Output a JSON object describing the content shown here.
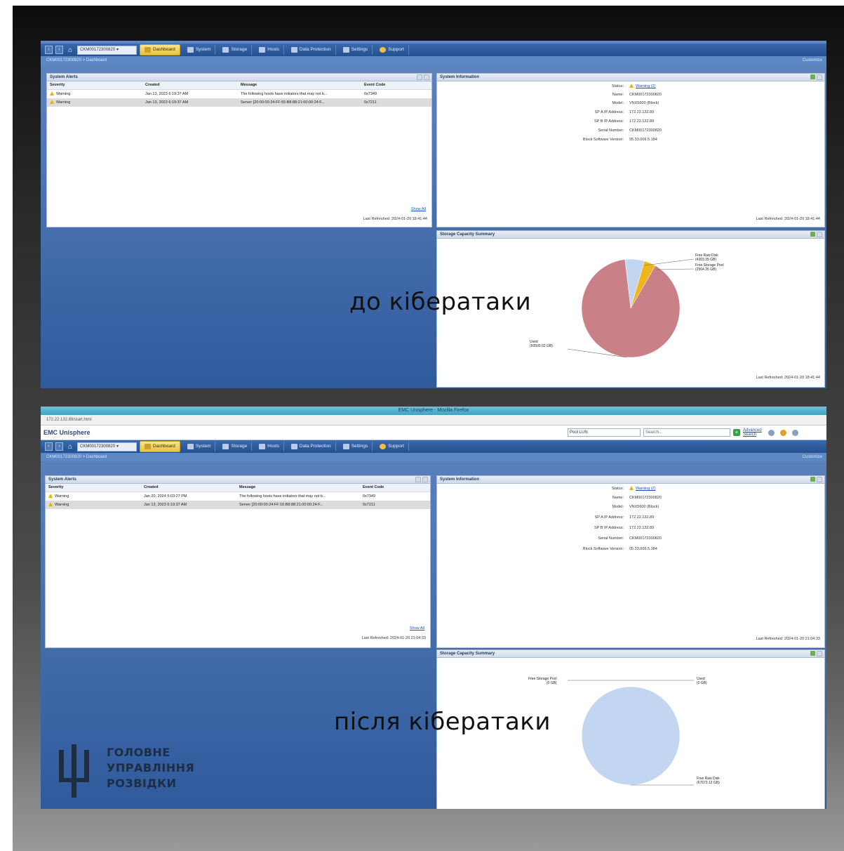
{
  "before": {
    "nav": {
      "system_select": "CKM00172300820",
      "tabs": [
        "Dashboard",
        "System",
        "Storage",
        "Hosts",
        "Data Protection",
        "Settings",
        "Support"
      ],
      "active_tab": "Dashboard"
    },
    "breadcrumb": "CKM00172300820 > Dashboard",
    "customize": "Customize",
    "alerts": {
      "title": "System Alerts",
      "columns": [
        "Severity",
        "Created",
        "Message",
        "Event Code"
      ],
      "rows": [
        {
          "severity": "Warning",
          "created": "Jan 13, 2023 6:19:37 AM",
          "message": "The following hosts have initiators that may not b...",
          "code": "0x7349"
        },
        {
          "severity": "Warning",
          "created": "Jan 13, 2023 6:19:37 AM",
          "message": "Server [20:00:00:24:FF:55:B8:88:21:00:00:24:F...",
          "code": "0x7211"
        }
      ],
      "show_all": "Show All",
      "last_refreshed": "Last Refreshed: 2024-01-20 18:41:44"
    },
    "sysinfo": {
      "title": "System Information",
      "fields": [
        {
          "label": "Status:",
          "value": "Warning (2)"
        },
        {
          "label": "Name:",
          "value": "CKM00172300820"
        },
        {
          "label": "Model:",
          "value": "VNX5600 (Block)"
        },
        {
          "label": "SP A IP Address:",
          "value": "172.22.132.89"
        },
        {
          "label": "SP B IP Address:",
          "value": "172.22.132.89"
        },
        {
          "label": "Serial Number:",
          "value": "CKM00172300820"
        },
        {
          "label": "Block Software Version:",
          "value": "05.33.009.5.184"
        }
      ],
      "last_refreshed": "Last Refreshed: 2024-01-20 18:41:44"
    },
    "capacity": {
      "title": "Storage Capacity Summary",
      "last_refreshed": "Last Refreshed: 2024-01-20 18:41:44",
      "labels": {
        "free_raw": "Free Raw Disk",
        "free_raw_val": "(4303.35 GB)",
        "free_pool": "Free Storage Pool",
        "free_pool_val": "(2564.35 GB)",
        "used": "Used",
        "used_val": "(60500.02 GB)"
      },
      "chart_data": {
        "type": "pie",
        "title": "Storage Capacity Summary",
        "categories": [
          "Used",
          "Free Raw Disk",
          "Free Storage Pool"
        ],
        "values": [
          60500.02,
          4303.35,
          2564.35
        ],
        "colors": [
          "#c98086",
          "#c2d6f2",
          "#f0b41c"
        ]
      }
    },
    "caption": "до кібератаки"
  },
  "after": {
    "window_title": "EMC Unisphere - Mozilla Firefox",
    "address": "172.22.132.89/start.html",
    "app_title": "EMC Unisphere",
    "search": {
      "filter": "Pool LUN",
      "placeholder": "Search...",
      "advanced": "Advanced Search"
    },
    "nav": {
      "system_select": "CKM00172300820",
      "tabs": [
        "Dashboard",
        "System",
        "Storage",
        "Hosts",
        "Data Protection",
        "Settings",
        "Support"
      ],
      "active_tab": "Dashboard"
    },
    "breadcrumb": "CKM00172300820 > Dashboard",
    "customize": "Customize",
    "alerts": {
      "title": "System Alerts",
      "columns": [
        "Severity",
        "Created",
        "Message",
        "Event Code"
      ],
      "rows": [
        {
          "severity": "Warning",
          "created": "Jan 20, 2024 5:03:27 PM",
          "message": "The following hosts have initiators that may not b...",
          "code": "0x7349"
        },
        {
          "severity": "Warning",
          "created": "Jan 13, 2023 6:19:37 AM",
          "message": "Server [20:00:00:24:FF:16:B8:88:21:00:00:24:F...",
          "code": "0x7211"
        }
      ],
      "show_all": "Show All",
      "last_refreshed": "Last Refreshed: 2024-01-20 21:04:33"
    },
    "sysinfo": {
      "title": "System Information",
      "fields": [
        {
          "label": "Status:",
          "value": "Warning (2)"
        },
        {
          "label": "Name:",
          "value": "CKM00172300820"
        },
        {
          "label": "Model:",
          "value": "VNX5600 (Block)"
        },
        {
          "label": "SP A IP Address:",
          "value": "172.22.132.89"
        },
        {
          "label": "SP B IP Address:",
          "value": "172.22.132.89"
        },
        {
          "label": "Serial Number:",
          "value": "CKM00172300820"
        },
        {
          "label": "Block Software Version:",
          "value": "05.33.009.5.184"
        }
      ],
      "last_refreshed": "Last Refreshed: 2024-01-20 21:04:33"
    },
    "capacity": {
      "title": "Storage Capacity Summary",
      "labels": {
        "free_pool": "Free Storage Pool",
        "free_pool_val": "(0 GB)",
        "used": "Used",
        "used_val": "(0 GB)",
        "free_raw": "Free Raw Disk",
        "free_raw_val": "(67673.12 GB)"
      },
      "chart_data": {
        "type": "pie",
        "title": "Storage Capacity Summary",
        "categories": [
          "Free Raw Disk",
          "Free Storage Pool",
          "Used"
        ],
        "values": [
          67673.12,
          0,
          0
        ],
        "colors": [
          "#c2d6f2",
          "#f0b41c",
          "#c98086"
        ]
      }
    },
    "caption": "після кібератаки"
  },
  "logo": {
    "line1": "ГОЛОВНЕ",
    "line2": "УПРАВЛІННЯ",
    "line3": "РОЗВІДКИ"
  }
}
